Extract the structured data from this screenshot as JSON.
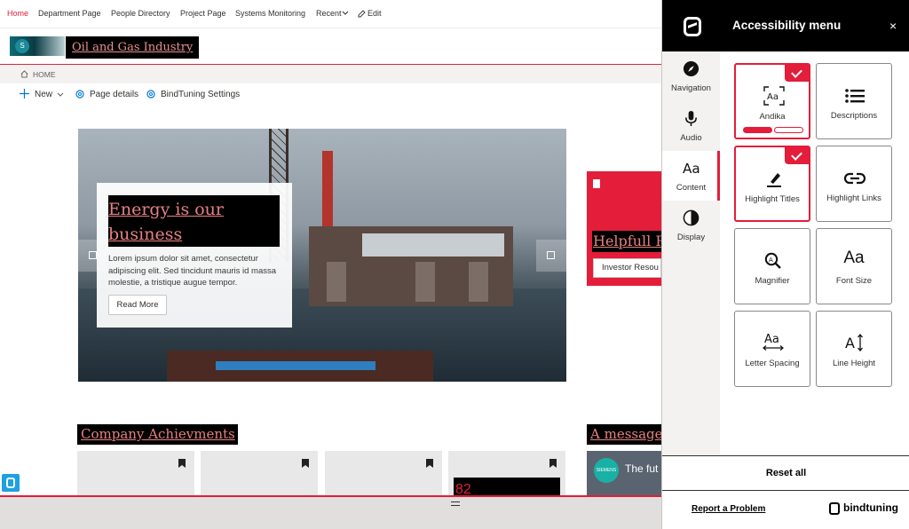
{
  "top_nav": {
    "items": [
      {
        "label": "Home",
        "active": true
      },
      {
        "label": "Department Page",
        "active": false
      },
      {
        "label": "People Directory",
        "active": false
      },
      {
        "label": "Project Page",
        "active": false
      },
      {
        "label": "Systems Monitoring",
        "active": false
      },
      {
        "label": "Recent",
        "active": false,
        "icon": "chevron-down-icon"
      }
    ],
    "edit_label": "Edit"
  },
  "site": {
    "logo_letter": "S",
    "title": "Oil and Gas Industry"
  },
  "breadcrumb": {
    "home": "HOME"
  },
  "command_bar": {
    "new_label": "New",
    "page_details_label": "Page details",
    "bindtuning_settings_label": "BindTuning Settings"
  },
  "hero": {
    "title": "Energy is our business",
    "body": "Lorem ipsum dolor sit amet, consectetur adipiscing elit. Sed tincidunt mauris id massa molestie, a tristique augue tempor.",
    "button_label": "Read More"
  },
  "side_card": {
    "heading": "Helpfull Re",
    "link_label": "Investor Resou"
  },
  "sections": {
    "achievements_title": "Company Achievments",
    "message_title": "A message",
    "tile_number": "82",
    "message_brand": "SIEMENS",
    "message_text": "The fut"
  },
  "accessibility_panel": {
    "title": "Accessibility menu",
    "close_label": "×",
    "sidebar": [
      {
        "label": "Navigation",
        "icon": "compass-icon",
        "active": false
      },
      {
        "label": "Audio",
        "icon": "microphone-icon",
        "active": false
      },
      {
        "label": "Content",
        "icon": "text-icon",
        "active": true
      },
      {
        "label": "Display",
        "icon": "contrast-icon",
        "active": false
      }
    ],
    "options": [
      {
        "label": "Andika",
        "icon": "font-face-icon",
        "selected": true
      },
      {
        "label": "Descriptions",
        "icon": "list-icon",
        "selected": false
      },
      {
        "label": "Highlight Titles",
        "icon": "highlighter-icon",
        "selected": true
      },
      {
        "label": "Highlight Links",
        "icon": "link-icon",
        "selected": false
      },
      {
        "label": "Magnifier",
        "icon": "magnifier-icon",
        "selected": false
      },
      {
        "label": "Font Size",
        "icon": "font-size-icon",
        "selected": false
      },
      {
        "label": "Letter Spacing",
        "icon": "letter-spacing-icon",
        "selected": false
      },
      {
        "label": "Line Height",
        "icon": "line-height-icon",
        "selected": false
      }
    ],
    "andika_level": {
      "value": 1,
      "max": 2
    },
    "reset_label": "Reset all",
    "report_label": "Report a Problem",
    "brand_label": "bindtuning"
  },
  "colors": {
    "accent": "#e31d3a",
    "panel_header": "#000000",
    "title_highlight_bg": "#000000",
    "title_highlight_text": "#e88080"
  }
}
